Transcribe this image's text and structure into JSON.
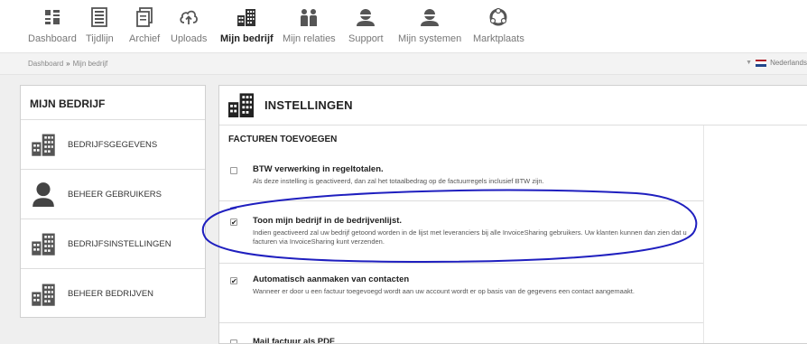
{
  "nav": {
    "items": [
      {
        "label": "Dashboard",
        "icon": "dashboard-icon"
      },
      {
        "label": "Tijdlijn",
        "icon": "timeline-icon"
      },
      {
        "label": "Archief",
        "icon": "archive-icon"
      },
      {
        "label": "Uploads",
        "icon": "upload-cloud-icon"
      },
      {
        "label": "Mijn bedrijf",
        "icon": "building-icon",
        "active": true
      },
      {
        "label": "Mijn relaties",
        "icon": "relations-icon"
      },
      {
        "label": "Support",
        "icon": "support-person-icon"
      },
      {
        "label": "Mijn systemen",
        "icon": "systems-person-icon"
      },
      {
        "label": "Marktplaats",
        "icon": "marketplace-icon"
      }
    ]
  },
  "breadcrumb": {
    "root": "Dashboard",
    "separator": "»",
    "current": "Mijn bedrijf"
  },
  "language": {
    "label": "Nederlands",
    "flag_colors": [
      "#ae1c28",
      "#ffffff",
      "#21468b"
    ]
  },
  "left_panel": {
    "title": "MIJN BEDRIJF",
    "items": [
      {
        "label": "BEDRIJFSGEGEVENS",
        "icon": "building-icon"
      },
      {
        "label": "BEHEER GEBRUIKERS",
        "icon": "user-icon"
      },
      {
        "label": "BEDRIJFSINSTELLINGEN",
        "icon": "building-icon"
      },
      {
        "label": "BEHEER BEDRIJVEN",
        "icon": "building-icon"
      }
    ]
  },
  "main": {
    "title": "INSTELLINGEN",
    "section_title": "FACTUREN TOEVOEGEN",
    "settings": [
      {
        "name": "BTW verwerking in regeltotalen.",
        "description": "Als deze instelling is geactiveerd, dan zal het totaalbedrag op de factuurregels inclusief BTW zijn.",
        "checked": false
      },
      {
        "name": "Toon mijn bedrijf in de bedrijvenlijst.",
        "description": "Indien geactiveerd zal uw bedrijf getoond worden in de lijst met leveranciers bij alle InvoiceSharing gebruikers. Uw klanten kunnen dan zien dat u facturen via InvoiceSharing kunt verzenden.",
        "checked": true
      },
      {
        "name": "Automatisch aanmaken van contacten",
        "description": "Wanneer er door u een factuur toegevoegd wordt aan uw account wordt er op basis van de gegevens een contact aangemaakt.",
        "checked": true
      },
      {
        "name": "Mail factuur als PDF",
        "description": "",
        "checked": false
      }
    ]
  },
  "colors": {
    "annotation": "#1f1fbf",
    "icon_dark": "#444444",
    "icon_grey": "#555555"
  }
}
